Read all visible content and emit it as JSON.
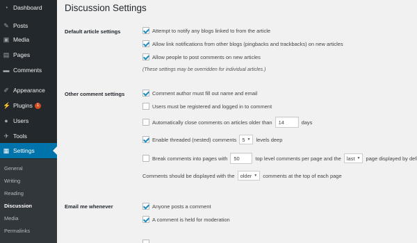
{
  "sidebar": {
    "items": [
      {
        "label": "Dashboard",
        "icon": "dashboard-icon"
      },
      {
        "label": "Posts",
        "icon": "pin-icon"
      },
      {
        "label": "Media",
        "icon": "media-icon"
      },
      {
        "label": "Pages",
        "icon": "page-icon"
      },
      {
        "label": "Comments",
        "icon": "comment-icon"
      },
      {
        "label": "Appearance",
        "icon": "brush-icon"
      },
      {
        "label": "Plugins",
        "icon": "plugin-icon",
        "badge": "1"
      },
      {
        "label": "Users",
        "icon": "user-icon"
      },
      {
        "label": "Tools",
        "icon": "wrench-icon"
      },
      {
        "label": "Settings",
        "icon": "settings-icon"
      }
    ],
    "submenu": [
      "General",
      "Writing",
      "Reading",
      "Discussion",
      "Media",
      "Permalinks"
    ],
    "active_color": "#0073aa",
    "badge_color": "#d54e21"
  },
  "page": {
    "title": "Discussion Settings"
  },
  "default_article": {
    "label": "Default article settings",
    "options": [
      {
        "text": "Attempt to notify any blogs linked to from the article",
        "checked": true
      },
      {
        "text": "Allow link notifications from other blogs (pingbacks and trackbacks) on new articles",
        "checked": true
      },
      {
        "text": "Allow people to post comments on new articles",
        "checked": true
      }
    ],
    "note": "(These settings may be overridden for individual articles.)"
  },
  "other_comment": {
    "label": "Other comment settings",
    "author_fill": "Comment author must fill out name and email",
    "registered": "Users must be registered and logged in to comment",
    "close_before": "Automatically close comments on articles older than",
    "close_days": "14",
    "close_after": "days",
    "threaded_before": "Enable threaded (nested) comments",
    "threaded_levels": "5",
    "threaded_after": "levels deep",
    "break_before": "Break comments into pages with",
    "break_count": "50",
    "break_mid": "top level comments per page and the",
    "break_page": "last",
    "break_after": "page displayed by default",
    "display_before": "Comments should be displayed with the",
    "display_order": "older",
    "display_after": "comments at the top of each page"
  },
  "email_me": {
    "label": "Email me whenever",
    "options": [
      {
        "text": "Anyone posts a comment",
        "checked": true
      },
      {
        "text": "A comment is held for moderation",
        "checked": true
      }
    ]
  }
}
